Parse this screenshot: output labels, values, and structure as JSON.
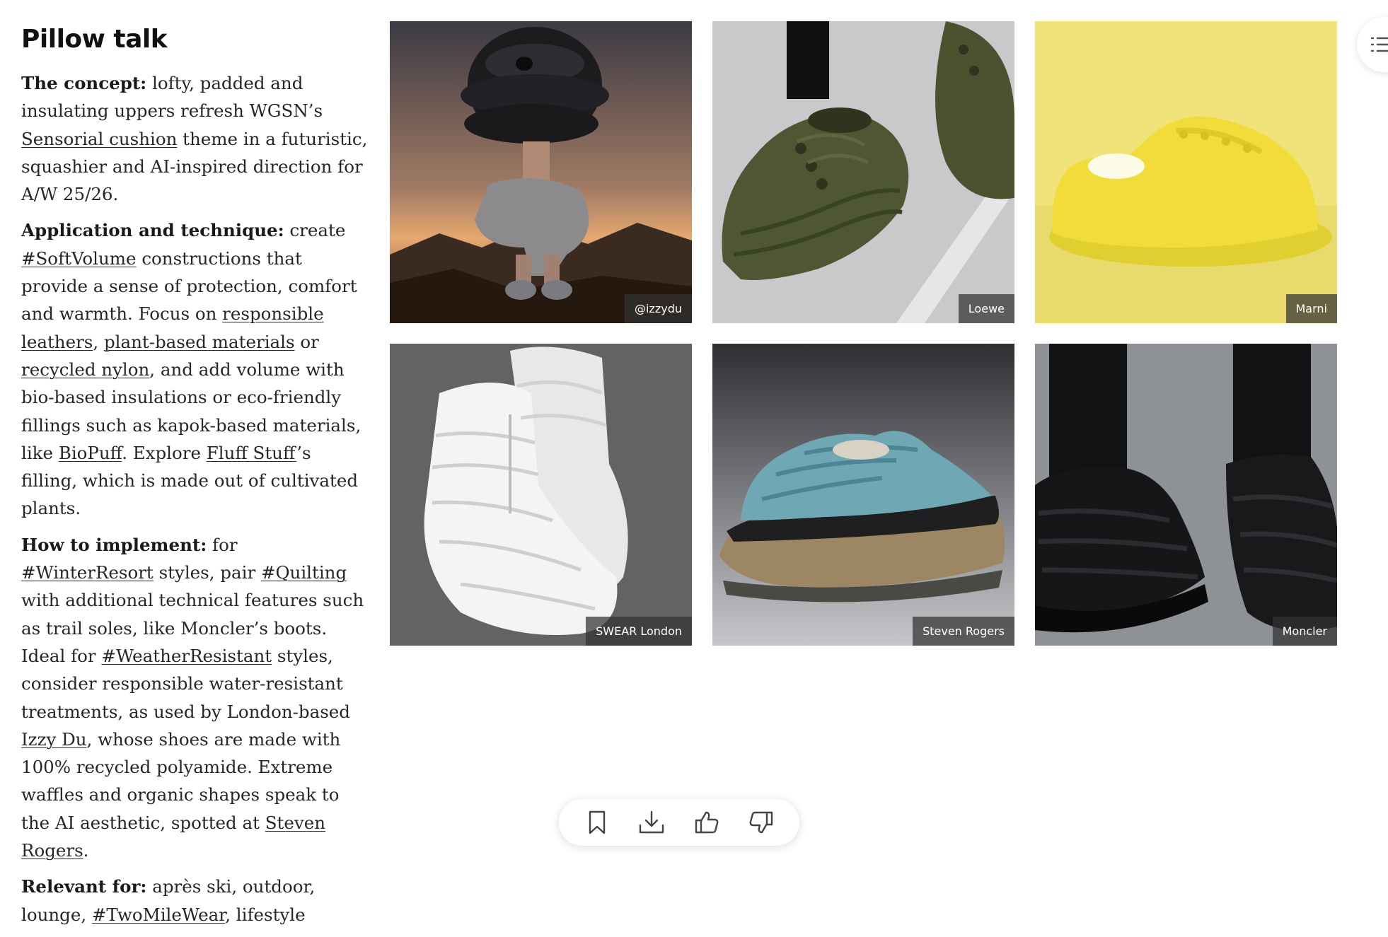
{
  "article": {
    "title": "Pillow talk",
    "concept": {
      "label": "The concept:",
      "t1": " lofty, padded and insulating uppers refresh WGSN’s ",
      "link1": "Sensorial cushion",
      "t2": " theme in a futuristic, squashier and AI-inspired direction for A/W 25/26."
    },
    "application": {
      "label": "Application and technique:",
      "t1": " create ",
      "link1": "#SoftVolume",
      "t2": " constructions that provide a sense of protection, comfort and warmth. Focus on ",
      "link2": "responsible leathers",
      "t3": ", ",
      "link3": "plant-based materials",
      "t4": " or ",
      "link4": "recycled nylon",
      "t5": ", and add volume with bio-based insulations or eco-friendly fillings such as kapok-based materials, like ",
      "link5": "BioPuff",
      "t6": ". Explore ",
      "link6": "Fluff Stuff",
      "t7": "’s filling, which is made out of cultivated plants."
    },
    "implement": {
      "label": "How to implement:",
      "t1": " for ",
      "link1": "#WinterResort",
      "t2": " styles, pair ",
      "link2": "#Quilting",
      "t3": " with additional technical features such as trail soles, like Moncler’s boots. Ideal for ",
      "link3": "#WeatherResistant",
      "t4": " styles, consider responsible water-resistant treatments, as used by London-based ",
      "link4": "Izzy Du",
      "t5": ", whose shoes are made with 100% recycled polyamide. Extreme waffles and organic shapes speak to the AI aesthetic, spotted at ",
      "link5": "Steven Rogers",
      "t6": "."
    },
    "relevant": {
      "label": "Relevant for:",
      "t1": " après ski, outdoor, lounge, ",
      "link1": "#TwoMileWear",
      "t2": ", lifestyle"
    }
  },
  "gallery": [
    {
      "credit": "@izzydu",
      "icon": "puffer-headpiece-figure"
    },
    {
      "credit": "Loewe",
      "icon": "olive-padded-sneaker"
    },
    {
      "credit": "Marni",
      "icon": "yellow-padded-sneaker"
    },
    {
      "credit": "SWEAR London",
      "icon": "white-quilted-boots"
    },
    {
      "credit": "Steven Rogers",
      "icon": "blue-puffer-trail-sneaker"
    },
    {
      "credit": "Moncler",
      "icon": "black-quilted-trail-shoes"
    }
  ],
  "toolbar": {
    "icons": [
      "bookmark-icon",
      "download-icon",
      "thumbs-up-icon",
      "thumbs-down-icon"
    ]
  },
  "side_panel": {
    "icon": "list-icon"
  },
  "colors": {
    "text": "#262626",
    "credit_bg": "#323232",
    "page_bg": "#ffffff"
  }
}
